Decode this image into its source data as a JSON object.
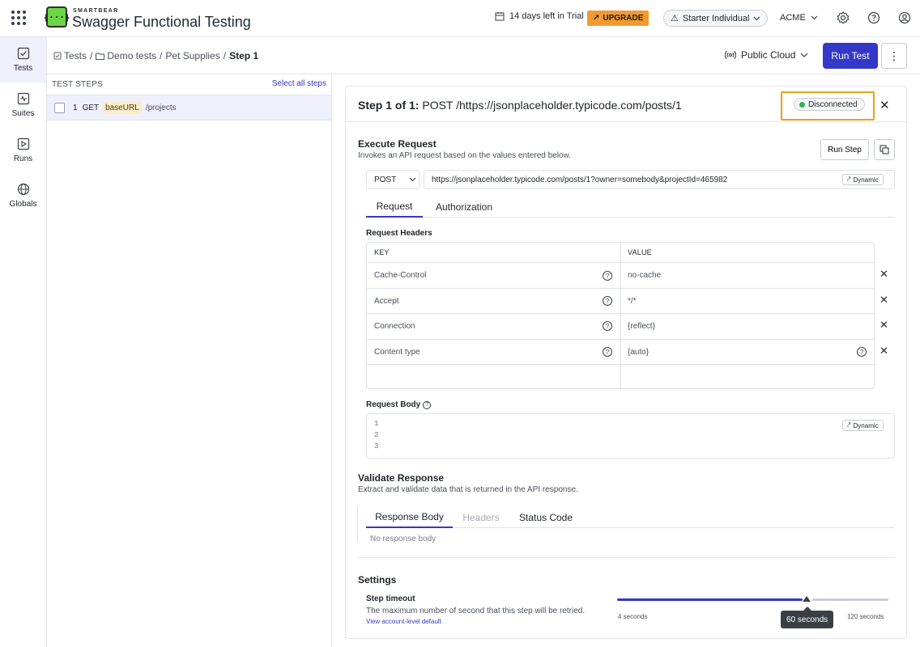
{
  "topbar": {
    "brand_small": "SMARTBEAR",
    "brand_title": "Swagger Functional Testing",
    "trial_text": "14 days left in Trial",
    "upgrade_label": "UPGRADE",
    "plan_label": "Starter Individual",
    "org_label": "ACME"
  },
  "nav": {
    "items": [
      {
        "label": "Tests"
      },
      {
        "label": "Suites"
      },
      {
        "label": "Runs"
      },
      {
        "label": "Globals"
      }
    ]
  },
  "subheader": {
    "breadcrumb": [
      "Tests",
      "Demo tests",
      "Pet Supplies",
      "Step 1"
    ],
    "cloud_label": "Public Cloud",
    "run_test_label": "Run Test",
    "more_label": "⋮"
  },
  "steps": {
    "header": "TEST STEPS",
    "select_all": "Select all steps",
    "rows": [
      {
        "number": "1",
        "method": "GET",
        "var": "baseURL",
        "path": "/projects"
      }
    ]
  },
  "detail": {
    "title_prefix": "Step 1 of 1:",
    "title_rest": "POST /https://jsonplaceholder.typicode.com/posts/1",
    "status": "Disconnected",
    "execute": {
      "title": "Execute Request",
      "subtitle": "Invokes an API request based on the values entered below.",
      "run_step_label": "Run Step",
      "method": "POST",
      "url": "https://jsonplaceholder.typicode.com/posts/1?owner=somebody&projectId=465982",
      "dynamic_label": "Dynamic",
      "tabs": [
        "Request",
        "Authorization"
      ]
    },
    "request_headers": {
      "title": "Request Headers",
      "columns": [
        "KEY",
        "VALUE"
      ],
      "rows": [
        {
          "key": "Cache-Control",
          "value": "no-cache"
        },
        {
          "key": "Accept",
          "value": "*/*"
        },
        {
          "key": "Connection",
          "value": "{reflect}"
        },
        {
          "key": "Content type",
          "value": "{auto}"
        }
      ]
    },
    "request_body": {
      "title": "Request Body",
      "lines": [
        "1",
        "2",
        "3"
      ],
      "dynamic_label": "Dynamic"
    },
    "validate": {
      "title": "Validate Response",
      "subtitle": "Extract and validate data that is returned in the API response.",
      "tabs": [
        "Response Body",
        "Headers",
        "Status Code"
      ],
      "empty_text": "No response body"
    },
    "settings": {
      "title": "Settings",
      "timeout_title": "Step timeout",
      "timeout_desc": "The maximum number of second that this step will be retried.",
      "link_label": "View account-level default",
      "slider_min_label": "4 seconds",
      "slider_max_label": "120 seconds",
      "slider_value_label": "60 seconds",
      "slider_min": 4,
      "slider_max": 120,
      "slider_value": 60
    }
  },
  "colors": {
    "accent": "#3338c9",
    "upgrade": "#f29a2e",
    "highlight": "#e6a218",
    "status_dot": "#33b24a",
    "logo": "#6bd643"
  }
}
